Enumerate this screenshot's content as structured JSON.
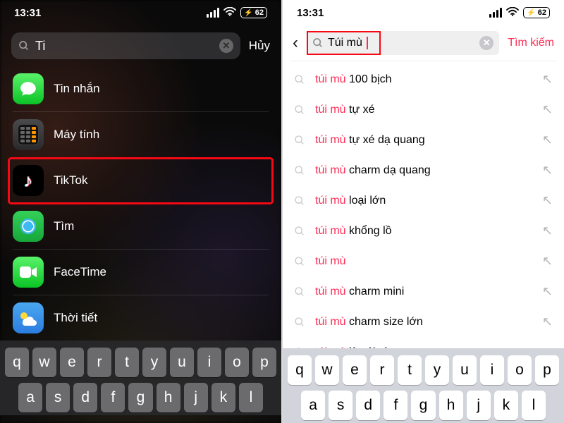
{
  "status": {
    "time": "13:31",
    "battery": "62"
  },
  "left": {
    "search_query": "Ti",
    "cancel": "Hủy",
    "results": [
      {
        "icon": "messages",
        "label": "Tin nhắn"
      },
      {
        "icon": "calculator",
        "label": "Máy tính"
      },
      {
        "icon": "tiktok",
        "label": "TikTok",
        "highlighted": true
      },
      {
        "icon": "findmy",
        "label": "Tìm"
      },
      {
        "icon": "facetime",
        "label": "FaceTime"
      },
      {
        "icon": "weather",
        "label": "Thời tiết"
      }
    ]
  },
  "right": {
    "search_query": "Túi mù",
    "search_button": "Tìm kiếm",
    "highlight_prefix": "túi mù",
    "suggestions": [
      {
        "rest": " 100 bịch"
      },
      {
        "rest": " tự xé"
      },
      {
        "rest": " tự xé dạ quang"
      },
      {
        "rest": " charm dạ quang"
      },
      {
        "rest": " loại lớn"
      },
      {
        "rest": " khổng lồ"
      },
      {
        "rest": ""
      },
      {
        "rest": " charm mini"
      },
      {
        "rest": " charm size lớn"
      },
      {
        "rest": " là cái gì"
      }
    ]
  },
  "keyboard": {
    "row1": [
      "q",
      "w",
      "e",
      "r",
      "t",
      "y",
      "u",
      "i",
      "o",
      "p"
    ],
    "row2": [
      "a",
      "s",
      "d",
      "f",
      "g",
      "h",
      "j",
      "k",
      "l"
    ]
  }
}
